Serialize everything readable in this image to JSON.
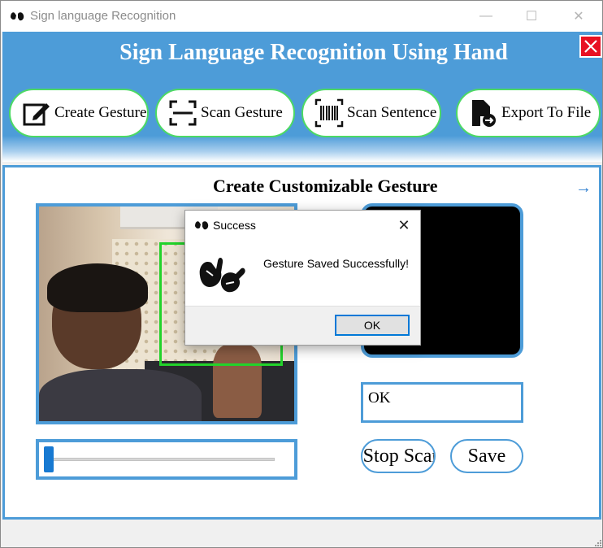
{
  "window": {
    "title": "Sign language Recognition",
    "controls": {
      "minimize": "—",
      "maximize": "☐",
      "close": "✕"
    }
  },
  "header": {
    "heading": "Sign Language Recognition Using Hand",
    "nav": [
      {
        "label": "Create Gesture",
        "icon": "edit-icon"
      },
      {
        "label": "Scan Gesture",
        "icon": "scan-frame-icon"
      },
      {
        "label": "Scan Sentence",
        "icon": "barcode-icon"
      },
      {
        "label": "Export To File",
        "icon": "export-file-icon"
      }
    ]
  },
  "panel": {
    "title": "Create Customizable Gesture",
    "arrow": "→",
    "gesture_name_value": "OK",
    "stop_label": "Stop Scan",
    "save_label": "Save",
    "slider_value": 0
  },
  "dialog": {
    "title": "Success",
    "message": "Gesture Saved Successfully!",
    "ok_label": "OK",
    "close": "✕"
  },
  "colors": {
    "accent": "#4d9cd8",
    "nav_border": "#4cd964",
    "roi": "#22d32a",
    "close_red": "#e81123",
    "slider": "#1779d1"
  }
}
